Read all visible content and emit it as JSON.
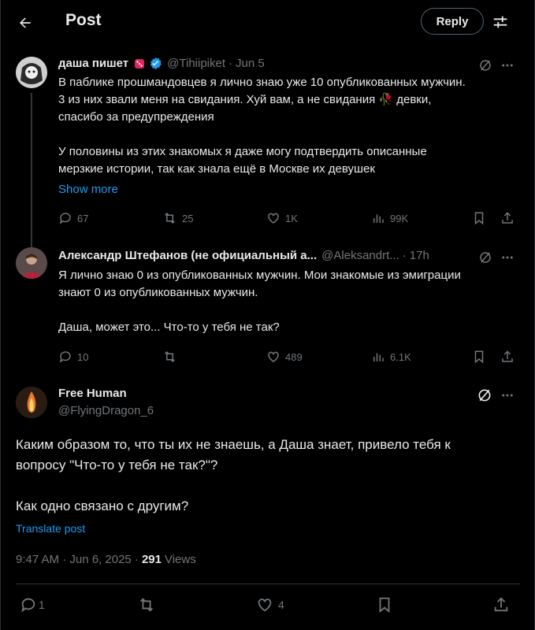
{
  "header": {
    "title": "Post",
    "reply_label": "Reply"
  },
  "tweet1": {
    "name": "даша пишет",
    "handle": "@Tihiipiket",
    "date": "Jun 5",
    "text": "В паблике прошмандовцев я лично знаю уже 10 опубликованных мужчин.\n3 из них звали меня на свидания. Хуй вам, а не свидания 🥀 девки,\nспасибо за предупреждения\n\nУ половины из этих знакомых я даже могу подтвердить описанные\nмерзкие истории, так как знала ещё в Москве их девушек",
    "show_more": "Show more",
    "replies": "67",
    "reposts": "25",
    "likes": "1K",
    "views": "99K"
  },
  "tweet2": {
    "name": "Александр Штефанов (не официальный а...",
    "handle": "@Aleksandrt...",
    "date": "17h",
    "text": "Я  лично знаю 0 из опубликованных мужчин. Мои знакомые из эмиграции\nзнают 0 из опубликованных  мужчин.\n\nДаша,  может это... Что-то у тебя не так?",
    "replies": "10",
    "reposts": "",
    "likes": "489",
    "views": "6.1K"
  },
  "tweet3": {
    "name": "Free Human",
    "handle": "@FlyingDragon_6",
    "text": "Каким образом то, что ты их не знаешь, а Даша знает, привело тебя к\nвопросу \"Что-то у тебя не так?\"?\n\nКак одно связано с другим?",
    "translate": "Translate post",
    "timestamp": "9:47 AM · Jun 6, 2025 ·",
    "views_count": "291",
    "views_label": "Views",
    "replies": "1",
    "reposts": "",
    "likes": "4"
  },
  "colors": {
    "background": "#000000",
    "text": "#e7e9ea",
    "muted": "#71767b",
    "accent": "#1d9bf0",
    "divider": "#2f3336"
  }
}
